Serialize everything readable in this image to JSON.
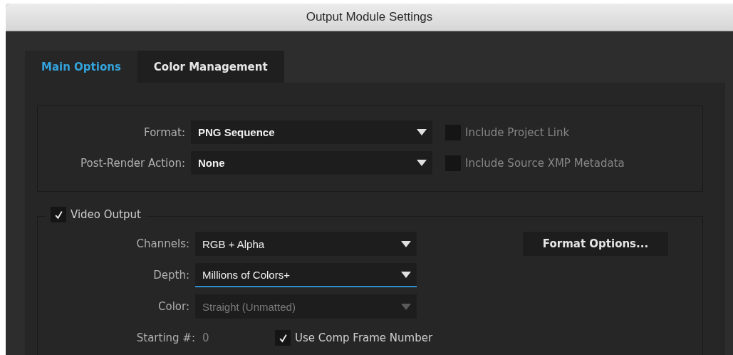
{
  "window": {
    "title": "Output Module Settings"
  },
  "tabs": [
    {
      "label": "Main Options",
      "selected": true
    },
    {
      "label": "Color Management",
      "selected": false
    }
  ],
  "format_group": {
    "rows": [
      {
        "label": "Format:",
        "value": "PNG Sequence",
        "option": {
          "label": "Include Project Link",
          "checked": false,
          "disabled": true
        }
      },
      {
        "label": "Post-Render Action:",
        "value": "None",
        "option": {
          "label": "Include Source XMP Metadata",
          "checked": false,
          "disabled": true
        }
      }
    ]
  },
  "video_output": {
    "label": "Video Output",
    "checked": true,
    "fields": [
      {
        "label": "Channels:",
        "value": "RGB + Alpha",
        "focused": false,
        "disabled": false
      },
      {
        "label": "Depth:",
        "value": "Millions of Colors+",
        "focused": true,
        "disabled": false
      },
      {
        "label": "Color:",
        "value": "Straight (Unmatted)",
        "focused": false,
        "disabled": true
      }
    ],
    "format_options_button": "Format Options...",
    "starting_number": {
      "label": "Starting #:",
      "value": "0"
    },
    "use_comp_frame": {
      "label": "Use Comp Frame Number",
      "checked": true,
      "disabled": false
    }
  }
}
